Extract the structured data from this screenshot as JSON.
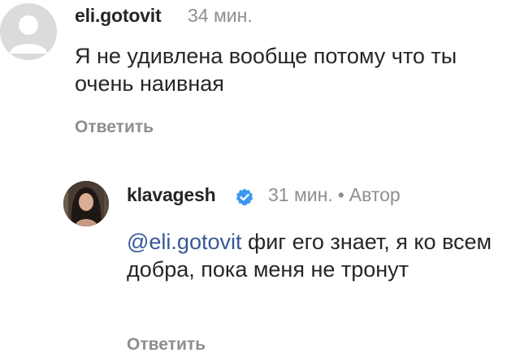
{
  "comments": [
    {
      "username": "eli.gotovit",
      "time": "34 мин.",
      "text": "Я не удивлена вообще потому что ты очень наивная",
      "reply_label": "Ответить"
    },
    {
      "username": "klavagesh",
      "time": "31 мин.",
      "separator": "•",
      "author_badge": "Автор",
      "mention": "@eli.gotovit",
      "text": "фиг его знает, я ко всем добра, пока меня не тронут",
      "reply_label": "Ответить",
      "verified_icon": "verified-badge-icon"
    }
  ],
  "colors": {
    "text": "#262626",
    "muted": "#8e8e8e",
    "mention": "#385898",
    "verified": "#3897f0",
    "avatar_placeholder": "#dbdbdb"
  }
}
